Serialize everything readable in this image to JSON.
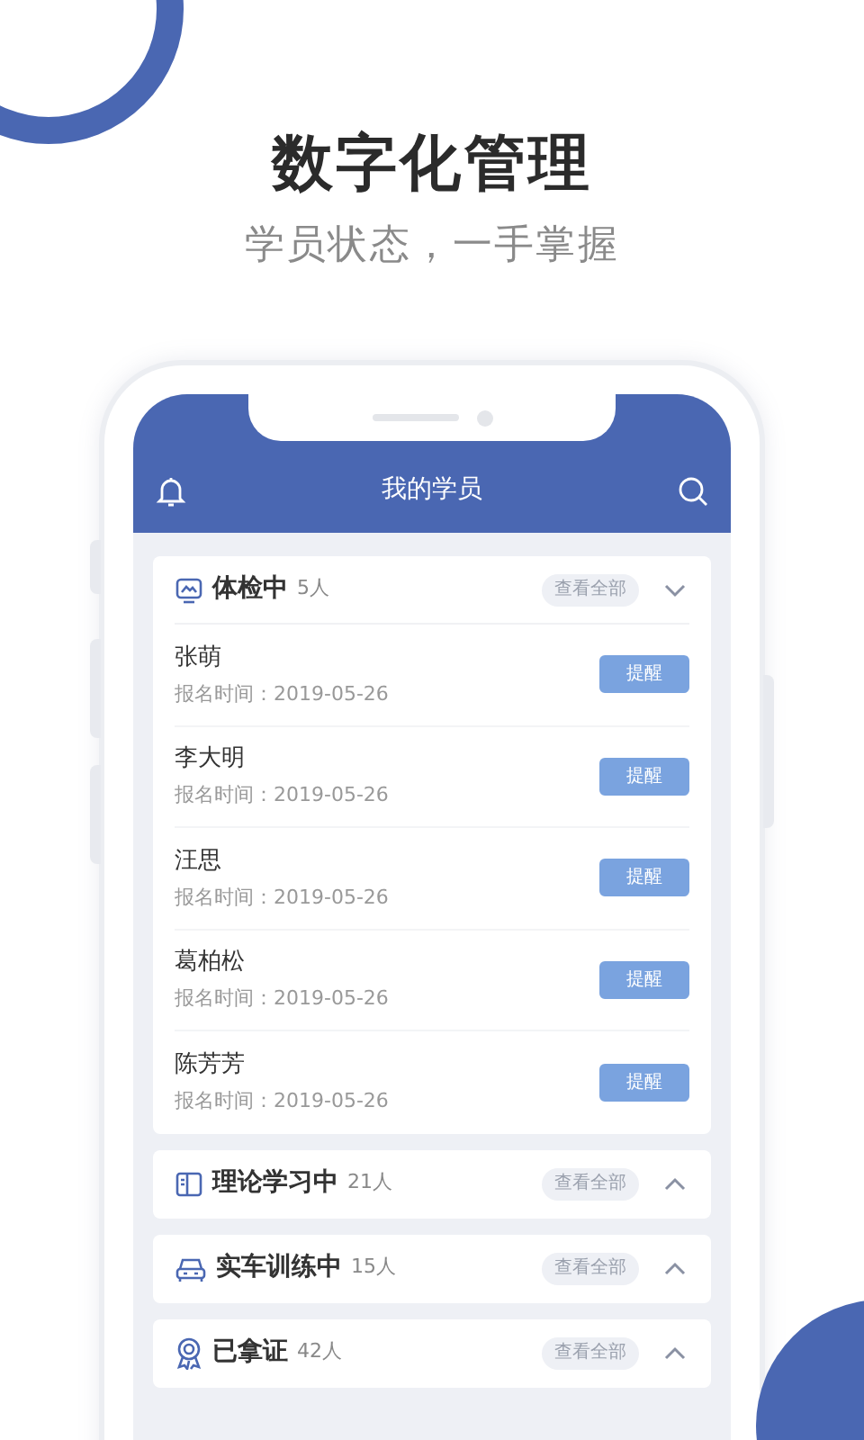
{
  "headline": "数字化管理",
  "subheadline": "学员状态，一手掌握",
  "app": {
    "title": "我的学员"
  },
  "groups": [
    {
      "kind": "health",
      "title": "体检中",
      "count": "5人",
      "view_all": "查看全部",
      "expanded": true,
      "students": [
        {
          "name": "张萌",
          "signup": "报名时间：2019-05-26",
          "action": "提醒"
        },
        {
          "name": "李大明",
          "signup": "报名时间：2019-05-26",
          "action": "提醒"
        },
        {
          "name": "汪思",
          "signup": "报名时间：2019-05-26",
          "action": "提醒"
        },
        {
          "name": "葛柏松",
          "signup": "报名时间：2019-05-26",
          "action": "提醒"
        },
        {
          "name": "陈芳芳",
          "signup": "报名时间：2019-05-26",
          "action": "提醒"
        }
      ]
    },
    {
      "kind": "theory",
      "title": "理论学习中",
      "count": "21人",
      "view_all": "查看全部",
      "expanded": false
    },
    {
      "kind": "driving",
      "title": "实车训练中",
      "count": "15人",
      "view_all": "查看全部",
      "expanded": false
    },
    {
      "kind": "certified",
      "title": "已拿证",
      "count": "42人",
      "view_all": "查看全部",
      "expanded": false
    }
  ]
}
